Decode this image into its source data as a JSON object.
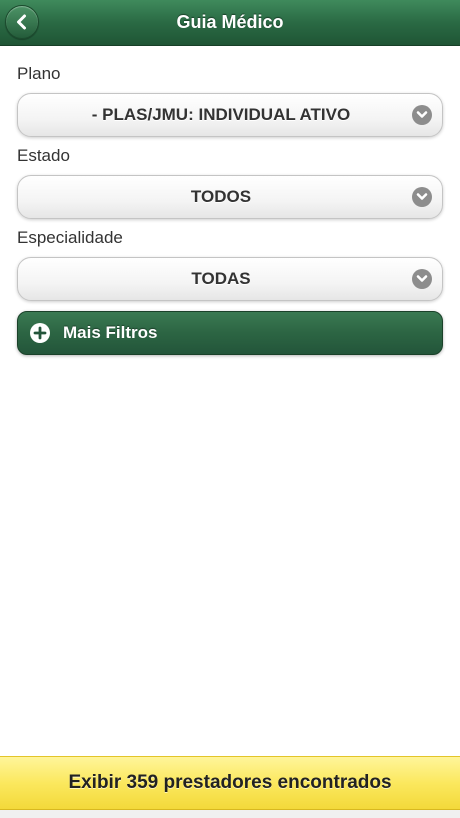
{
  "header": {
    "title": "Guia Médico",
    "back_icon": "chevron-left-icon",
    "colors": {
      "bar": "#2a6a44"
    }
  },
  "filters": {
    "plano": {
      "label": "Plano",
      "selected": "- PLAS/JMU: INDIVIDUAL ATIVO"
    },
    "estado": {
      "label": "Estado",
      "selected": "TODOS"
    },
    "especialidade": {
      "label": "Especialidade",
      "selected": "TODAS"
    },
    "select_icon": "chevron-down-icon"
  },
  "more_filters": {
    "label": "Mais Filtros",
    "icon": "plus-icon",
    "color": "#2c6543"
  },
  "footer": {
    "label": "Exibir 359 prestadores encontrados",
    "color": "#fbe85e"
  }
}
